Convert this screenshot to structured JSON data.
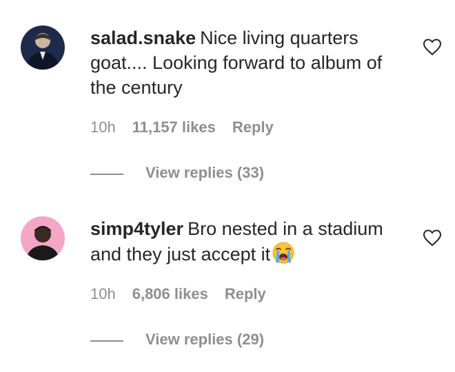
{
  "comments": [
    {
      "username": "salad.snake",
      "text": "Nice living quarters goat.... Looking forward to album of the century",
      "emoji": "",
      "time": "10h",
      "likes": "11,157 likes",
      "reply_label": "Reply",
      "view_replies": "View replies (33)",
      "avatar_icon": "avatar-dark-portrait",
      "heart_icon": "heart-outline-icon"
    },
    {
      "username": "simp4tyler",
      "text": "Bro nested in a stadium and they just accept it",
      "emoji": "loudly-crying-face-emoji",
      "time": "10h",
      "likes": "6,806 likes",
      "reply_label": "Reply",
      "view_replies": "View replies (29)",
      "avatar_icon": "avatar-pink-portrait",
      "heart_icon": "heart-outline-icon"
    }
  ],
  "colors": {
    "text_primary": "#262626",
    "text_secondary": "#8e8e8e",
    "avatar1_bg": "#1e2a4a",
    "avatar2_bg": "#f4a6c6"
  }
}
